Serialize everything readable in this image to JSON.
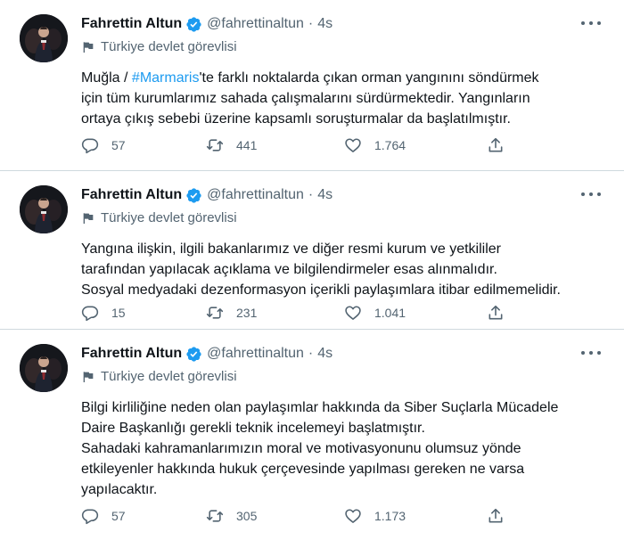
{
  "tweets": [
    {
      "author_name": "Fahrettin Altun",
      "handle": "@fahrettinaltun",
      "separator": "·",
      "time": "4s",
      "label": "Türkiye devlet görevlisi",
      "body": {
        "line1_prefix": "Muğla / ",
        "line1_hashtag": "#Marmaris",
        "line1_suffix": "'te farklı noktalarda çıkan orman yangınını söndürmek",
        "line2": "için tüm kurumlarımız sahada çalışmalarını sürdürmektedir. Yangınların",
        "line3": "ortaya çıkış sebebi üzerine kapsamlı  soruşturmalar da başlatılmıştır."
      },
      "replies": "57",
      "retweets": "441",
      "likes": "1.764"
    },
    {
      "author_name": "Fahrettin Altun",
      "handle": "@fahrettinaltun",
      "separator": "·",
      "time": "4s",
      "label": "Türkiye devlet görevlisi",
      "body": {
        "line1": "Yangına ilişkin, ilgili bakanlarımız ve diğer resmi kurum ve yetkililer",
        "line2": "tarafından yapılacak açıklama ve bilgilendirmeler esas alınmalıdır.",
        "line3": "Sosyal medyadaki dezenformasyon içerikli paylaşımlara itibar edilmemelidir."
      },
      "replies": "15",
      "retweets": "231",
      "likes": "1.041"
    },
    {
      "author_name": "Fahrettin Altun",
      "handle": "@fahrettinaltun",
      "separator": "·",
      "time": "4s",
      "label": "Türkiye devlet görevlisi",
      "body": {
        "line1": "Bilgi kirliliğine neden olan paylaşımlar hakkında da Siber Suçlarla Mücadele",
        "line2": "Daire Başkanlığı gerekli teknik incelemeyi başlatmıştır.",
        "line3": "Sahadaki kahramanlarımızın moral ve motivasyonunu olumsuz yönde",
        "line4": "etkileyenler hakkında hukuk çerçevesinde yapılması gereken ne varsa",
        "line5": "yapılacaktır."
      },
      "replies": "57",
      "retweets": "305",
      "likes": "1.173"
    }
  ],
  "colors": {
    "accent": "#1d9bf0",
    "text_primary": "#0f1419",
    "text_secondary": "#536471",
    "divider": "#cfd9de"
  },
  "icons": {
    "verified": "verified-badge-icon",
    "label": "flag-icon",
    "reply": "reply-icon",
    "retweet": "retweet-icon",
    "like": "like-icon",
    "share": "share-icon",
    "more": "more-icon"
  }
}
